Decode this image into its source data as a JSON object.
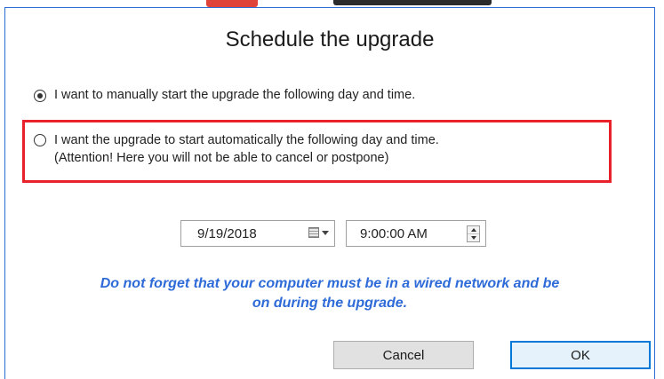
{
  "dialog": {
    "title": "Schedule the upgrade",
    "options": [
      {
        "label": "I want to manually start the upgrade the following day and time.",
        "selected": true
      },
      {
        "label_lines": [
          "I want the upgrade to start automatically the following day and time.",
          "(Attention! Here you will not be able to cancel or postpone)"
        ],
        "selected": false,
        "highlighted": true
      }
    ],
    "date_picker": {
      "value": "9/19/2018",
      "icon": "calendar-icon"
    },
    "time_picker": {
      "value": "9:00:00 AM",
      "icon": "spinner-icon"
    },
    "notice_lines": [
      "Do not forget that your computer must be in a wired network and be",
      "on during the upgrade."
    ],
    "buttons": {
      "cancel": "Cancel",
      "ok": "OK"
    }
  },
  "colors": {
    "accent_border": "#2d6bd6",
    "highlight_box": "#e8212b",
    "notice_text": "#2e6bd8",
    "ok_button_border": "#0078d7"
  }
}
